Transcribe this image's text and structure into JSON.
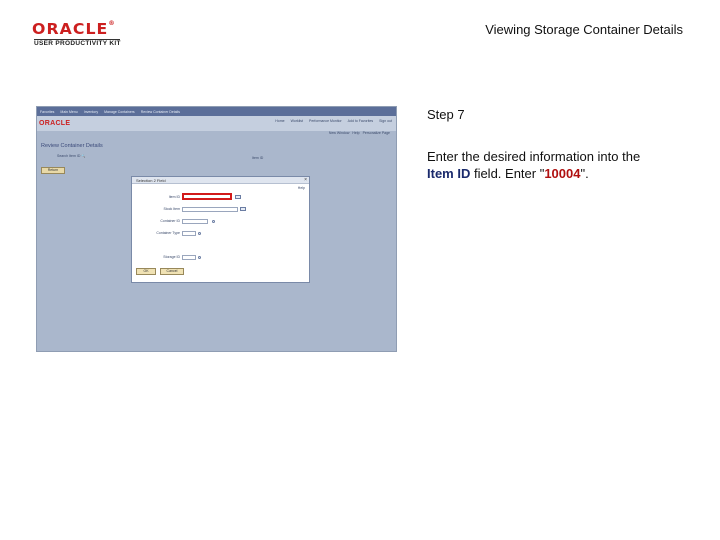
{
  "header": {
    "logo_brand": "ORACLE",
    "logo_tagline": "USER PRODUCTIVITY KIT",
    "title": "Viewing Storage Container Details"
  },
  "step": {
    "label": "Step 7",
    "text_before": "Enter the desired information into the ",
    "field_name": "Item ID",
    "text_middle": " field. Enter \"",
    "value": "10004",
    "text_after": "\"."
  },
  "screenshot": {
    "top_nav": [
      "Favorites",
      "Main Menu",
      "Inventory",
      "Manage Containers",
      "Review Container Details"
    ],
    "brand": "ORACLE",
    "header_links": [
      "Home",
      "Worklist",
      "Performance Monitor",
      "Add to Favorites",
      "Sign out"
    ],
    "content_links": [
      "New Window",
      "Help",
      "Personalize Page"
    ],
    "page_title": "Review Container Details",
    "sub_label": "Search Item ID",
    "sub_label_right": "Item ID",
    "return_button": "Return",
    "dialog": {
      "title": "Selection 2 Field",
      "close": "×",
      "help": "Help",
      "fields": [
        "Item ID",
        "Stock Item",
        "Container ID",
        "Container Type",
        "Storage ID"
      ],
      "ok_label": "OK",
      "cancel_label": "Cancel"
    }
  },
  "colors": {
    "accent_red": "#cc1f1f",
    "field_blue": "#1a2a6c",
    "screenshot_bg": "#aab7cc"
  }
}
